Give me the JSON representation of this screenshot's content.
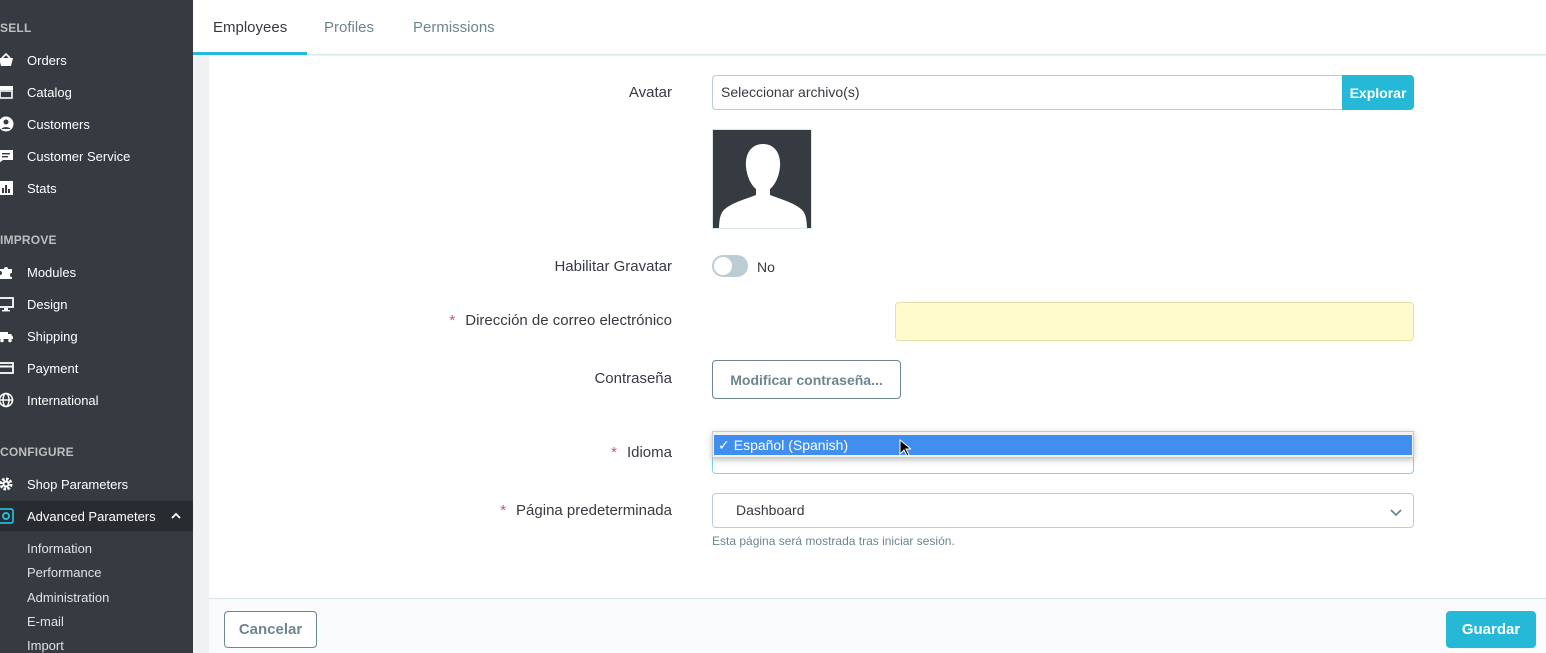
{
  "sidebar": {
    "sections": {
      "sell": "SELL",
      "improve": "IMPROVE",
      "configure": "CONFIGURE"
    },
    "items": {
      "orders": "Orders",
      "catalog": "Catalog",
      "customers": "Customers",
      "customer_service": "Customer Service",
      "stats": "Stats",
      "modules": "Modules",
      "design": "Design",
      "shipping": "Shipping",
      "payment": "Payment",
      "international": "International",
      "shop_parameters": "Shop Parameters",
      "advanced_parameters": "Advanced Parameters"
    },
    "subitems": {
      "information": "Information",
      "performance": "Performance",
      "administration": "Administration",
      "email": "E-mail",
      "import": "Import"
    }
  },
  "tabs": {
    "employees": "Employees",
    "profiles": "Profiles",
    "permissions": "Permissions"
  },
  "form": {
    "avatar_label": "Avatar",
    "file_placeholder": "Seleccionar archivo(s)",
    "browse_button": "Explorar",
    "gravatar_label": "Habilitar Gravatar",
    "gravatar_value": "No",
    "email_label": "Dirección de correo electrónico",
    "password_label": "Contraseña",
    "change_password_button": "Modificar contraseña...",
    "language_label": "Idioma",
    "language_selected": "Español (Spanish)",
    "default_page_label": "Página predeterminada",
    "default_page_value": "Dashboard",
    "default_page_help": "Esta página será mostrada tras iniciar sesión.",
    "required_mark": "*"
  },
  "footer": {
    "cancel_button": "Cancelar",
    "save_button": "Guardar"
  },
  "colors": {
    "accent": "#25b9d7",
    "sidebar_bg": "#363a41",
    "highlight": "#3f8ef0",
    "email_bg": "#fffbcc"
  }
}
